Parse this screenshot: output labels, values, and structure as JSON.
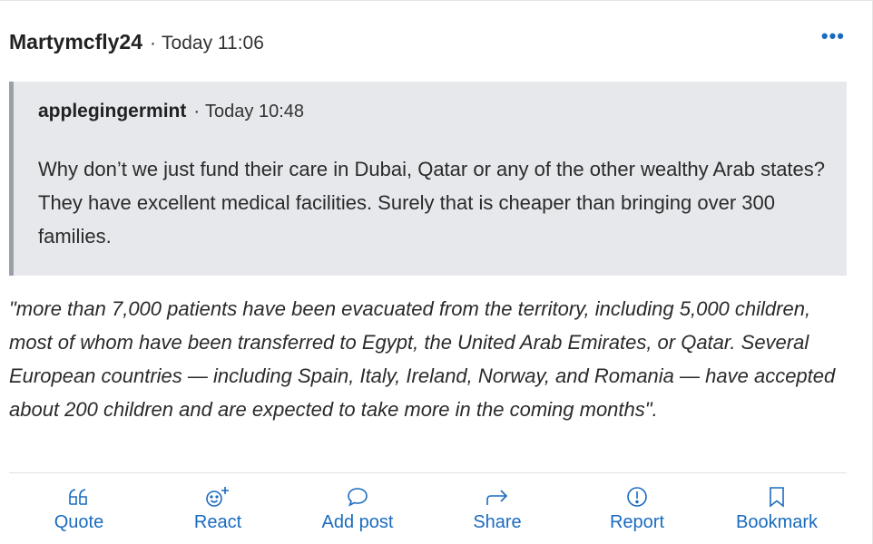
{
  "post": {
    "author": "Martymcfly24",
    "separator": "·",
    "time": "Today 11:06",
    "menu_label": "•••"
  },
  "quote": {
    "author": "applegingermint",
    "separator": "·",
    "time": "Today 10:48",
    "text": "Why don’t we just fund their care in Dubai, Qatar or any of the other wealthy Arab states? They have excellent medical facilities. Surely that is cheaper than bringing over 300 families."
  },
  "body": {
    "text": "\"more than 7,000 patients have been evacuated from the territory, including 5,000 children, most of whom have been transferred to Egypt, the United Arab Emirates, or Qatar. Several European countries — including Spain, Italy, Ireland, Norway, and Romania — have accepted about 200 children and are expected to take more in the coming months\"."
  },
  "actions": {
    "quote": {
      "label": "Quote",
      "icon": "quote-icon"
    },
    "react": {
      "label": "React",
      "icon": "react-smiley-icon"
    },
    "add_post": {
      "label": "Add post",
      "icon": "speech-bubble-icon"
    },
    "share": {
      "label": "Share",
      "icon": "share-arrow-icon"
    },
    "report": {
      "label": "Report",
      "icon": "exclamation-circle-icon"
    },
    "bookmark": {
      "label": "Bookmark",
      "icon": "bookmark-icon"
    }
  },
  "colors": {
    "accent": "#1a6bbf",
    "quote_background": "#e6e8ec",
    "quote_border": "#9aa0a8"
  }
}
